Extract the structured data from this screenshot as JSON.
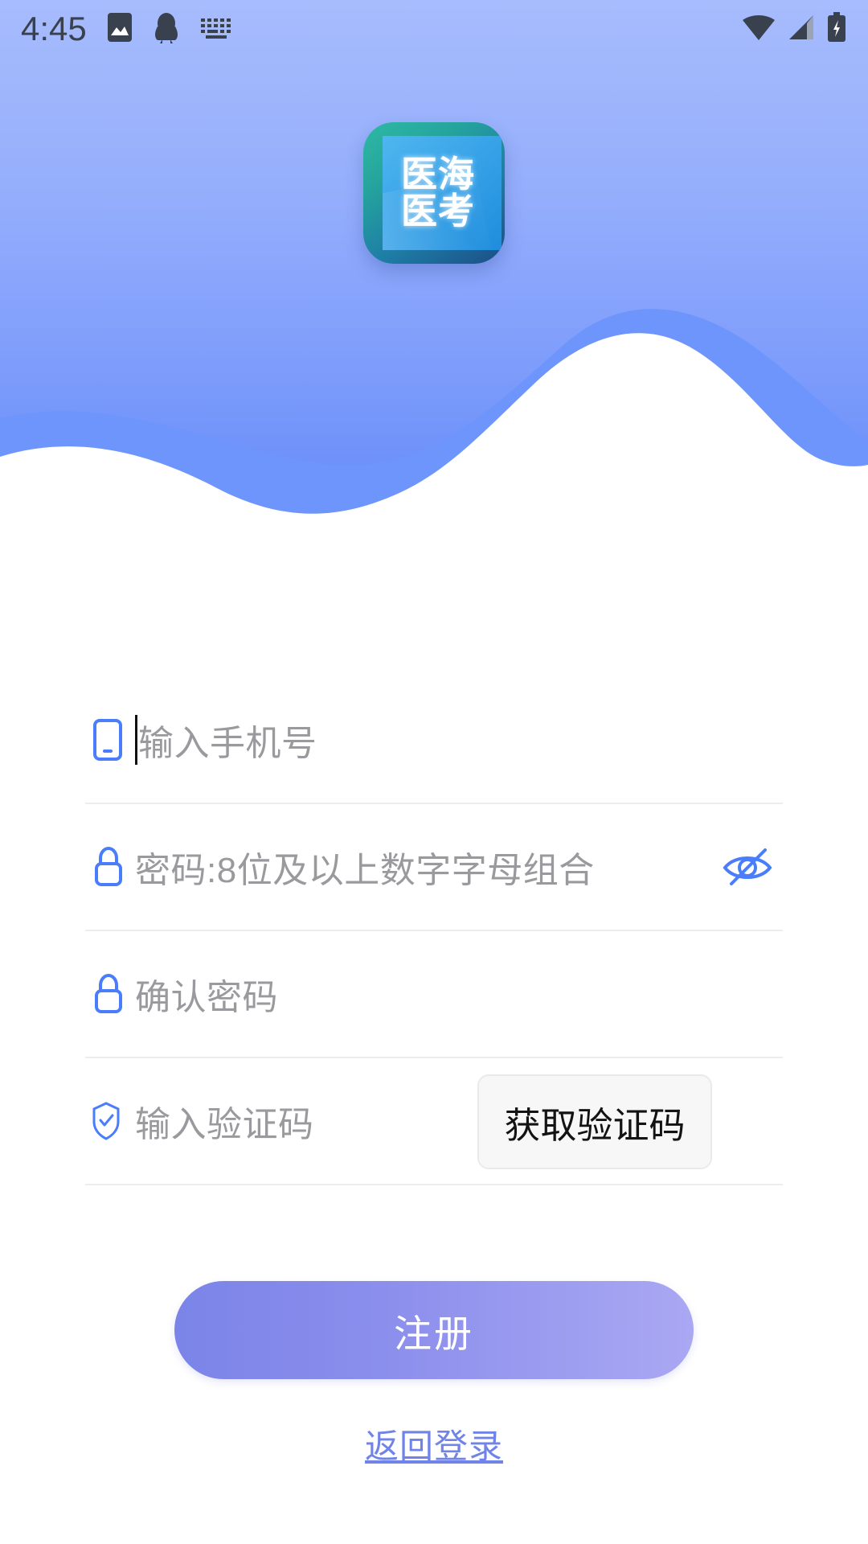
{
  "status_bar": {
    "time": "4:45",
    "left_icons": [
      "image-icon",
      "qq-penguin-icon",
      "keyboard-icon"
    ],
    "right_icons": [
      "wifi-icon",
      "cellular-signal-icon",
      "battery-charging-icon"
    ]
  },
  "branding": {
    "logo_line1": "医海",
    "logo_line2": "医考",
    "logo_border_color": "#24a79f",
    "logo_inner_color": "#2f9fe2"
  },
  "theme": {
    "header_gradient_top": "#a7bcfd",
    "header_gradient_bottom": "#5f87f9",
    "wave_back_color": "#4f83f8",
    "wave_front_color": "#6d95fb",
    "accent_blue": "#4a7dfa",
    "placeholder_gray": "#9a9a9e",
    "submit_gradient_left": "#7b84e8",
    "submit_gradient_right": "#aaa8f3",
    "link_color": "#7083e8"
  },
  "form": {
    "fields": [
      {
        "name": "phone",
        "icon": "mobile-phone-icon",
        "placeholder": "输入手机号",
        "value": "",
        "focused": true
      },
      {
        "name": "password",
        "icon": "lock-icon",
        "placeholder": "密码:8位及以上数字字母组合",
        "value": "",
        "trailing_icon": "eye-off-icon",
        "focused": false
      },
      {
        "name": "confirm_password",
        "icon": "lock-icon",
        "placeholder": "确认密码",
        "value": "",
        "focused": false
      },
      {
        "name": "verification_code",
        "icon": "shield-check-icon",
        "placeholder": "输入验证码",
        "value": "",
        "focused": false
      }
    ],
    "send_code_label": "获取验证码"
  },
  "actions": {
    "submit_label": "注册",
    "back_to_login_label": "返回登录"
  }
}
